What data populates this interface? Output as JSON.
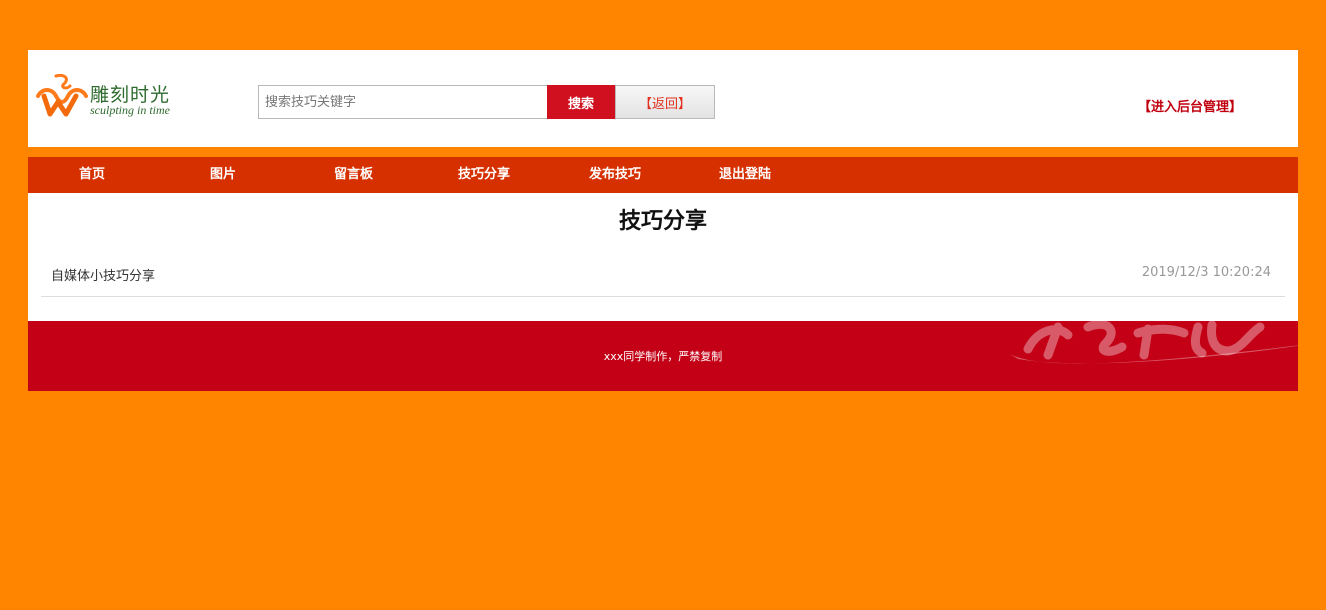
{
  "logo": {
    "name_cn": "雕刻时光",
    "name_en": "sculpting in time"
  },
  "search": {
    "placeholder": "搜索技巧关键字",
    "value": "",
    "button_label": "搜索",
    "back_label": "【返回】"
  },
  "header": {
    "admin_link": "【进入后台管理】"
  },
  "nav": {
    "items": [
      {
        "label": "首页"
      },
      {
        "label": "图片"
      },
      {
        "label": "留言板"
      },
      {
        "label": "技巧分享"
      },
      {
        "label": "发布技巧"
      },
      {
        "label": "退出登陆"
      }
    ]
  },
  "main": {
    "title": "技巧分享",
    "articles": [
      {
        "title": "自媒体小技巧分享",
        "date": "2019/12/3 10:20:24"
      }
    ]
  },
  "footer": {
    "text": "xxx同学制作，严禁复制"
  },
  "colors": {
    "page_bg": "#FF8400",
    "nav_bg": "#D63000",
    "search_button": "#D0101F",
    "admin_link": "#C0000F",
    "footer_bg": "#C30016"
  },
  "icons": [
    "logo-mark-icon",
    "footer-decoration-icon"
  ]
}
